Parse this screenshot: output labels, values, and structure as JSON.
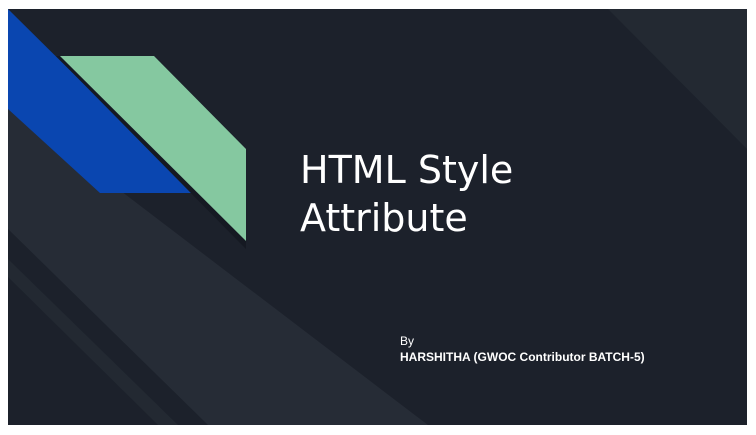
{
  "slide": {
    "title_line1": "HTML Style",
    "title_line2": "Attribute",
    "by_label": "By",
    "author": "HARSHITHA (GWOC Contributor BATCH-5)"
  },
  "colors": {
    "background": "#1c212b",
    "stripe_light": "#262c36",
    "accent_blue": "#0a46b0",
    "accent_green": "#85c8a0",
    "text": "#ffffff"
  }
}
